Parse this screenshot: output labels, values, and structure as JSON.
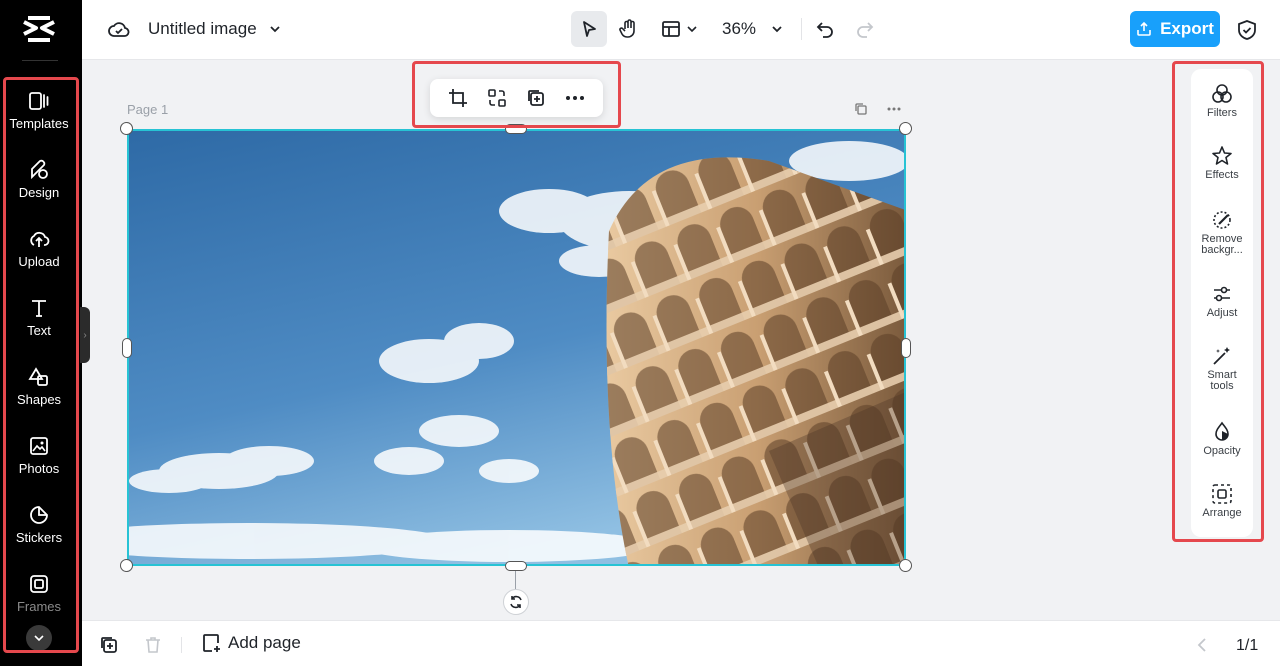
{
  "left_nav": {
    "items": [
      {
        "label": "Templates",
        "icon": "templates-icon"
      },
      {
        "label": "Design",
        "icon": "design-icon"
      },
      {
        "label": "Upload",
        "icon": "upload-icon"
      },
      {
        "label": "Text",
        "icon": "text-icon"
      },
      {
        "label": "Shapes",
        "icon": "shapes-icon"
      },
      {
        "label": "Photos",
        "icon": "photos-icon"
      },
      {
        "label": "Stickers",
        "icon": "stickers-icon"
      },
      {
        "label": "Frames",
        "icon": "frames-icon"
      }
    ]
  },
  "header": {
    "title": "Untitled image",
    "zoom": "36%",
    "export_label": "Export"
  },
  "canvas": {
    "page_label": "Page 1"
  },
  "right_panel": {
    "items": [
      {
        "label": "Filters",
        "icon": "filters-icon"
      },
      {
        "label": "Effects",
        "icon": "effects-icon"
      },
      {
        "label": "Remove backgr...",
        "icon": "remove-background-icon"
      },
      {
        "label": "Adjust",
        "icon": "adjust-icon"
      },
      {
        "label": "Smart tools",
        "icon": "smart-tools-icon"
      },
      {
        "label": "Opacity",
        "icon": "opacity-icon"
      },
      {
        "label": "Arrange",
        "icon": "arrange-icon"
      }
    ]
  },
  "footer": {
    "add_page_label": "Add page",
    "page_indicator": "1/1"
  },
  "colors": {
    "accent": "#18a0fb",
    "selection": "#27c3d4",
    "highlight": "#e5484d"
  }
}
